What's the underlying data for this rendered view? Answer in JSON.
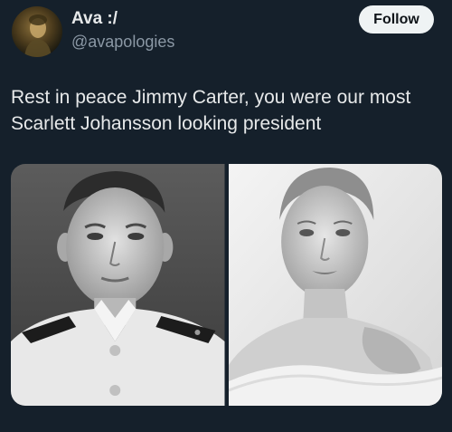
{
  "tweet": {
    "author": {
      "display_name": "Ava :/",
      "handle": "@avapologies",
      "avatar_icon": "avatar-photo"
    },
    "follow_label": "Follow",
    "text": "Rest in peace Jimmy Carter, you were our most Scarlett Johansson looking president",
    "media": [
      {
        "name": "media-photo-left",
        "description_icon": "portrait-photo"
      },
      {
        "name": "media-photo-right",
        "description_icon": "portrait-photo"
      }
    ]
  },
  "colors": {
    "background": "#15202b",
    "text_primary": "#e7e9ea",
    "text_secondary": "#8b98a5",
    "follow_bg": "#eff3f4",
    "follow_text": "#0f1419"
  }
}
